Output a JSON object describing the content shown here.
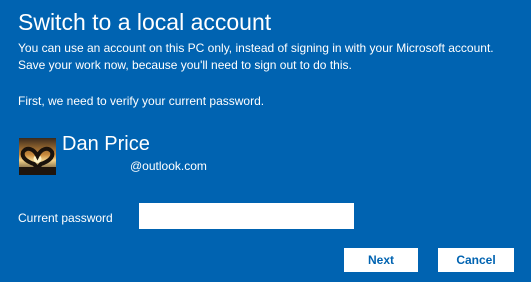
{
  "dialog": {
    "title": "Switch to a local account",
    "description_line1": "You can use an account on this PC only, instead of signing in with your Microsoft account.",
    "description_line2": "Save your work now, because you'll need to sign out to do this.",
    "verify_text": "First, we need to verify your current password."
  },
  "user": {
    "name": "Dan Price",
    "email": "@outlook.com",
    "avatar_icon": "user-photo-heart-hands-sunset"
  },
  "password_field": {
    "label": "Current password",
    "value": "",
    "placeholder": ""
  },
  "buttons": {
    "next_label": "Next",
    "cancel_label": "Cancel"
  },
  "colors": {
    "background": "#0063b1",
    "text": "#ffffff",
    "button_background": "#ffffff",
    "button_text": "#0063b1"
  }
}
